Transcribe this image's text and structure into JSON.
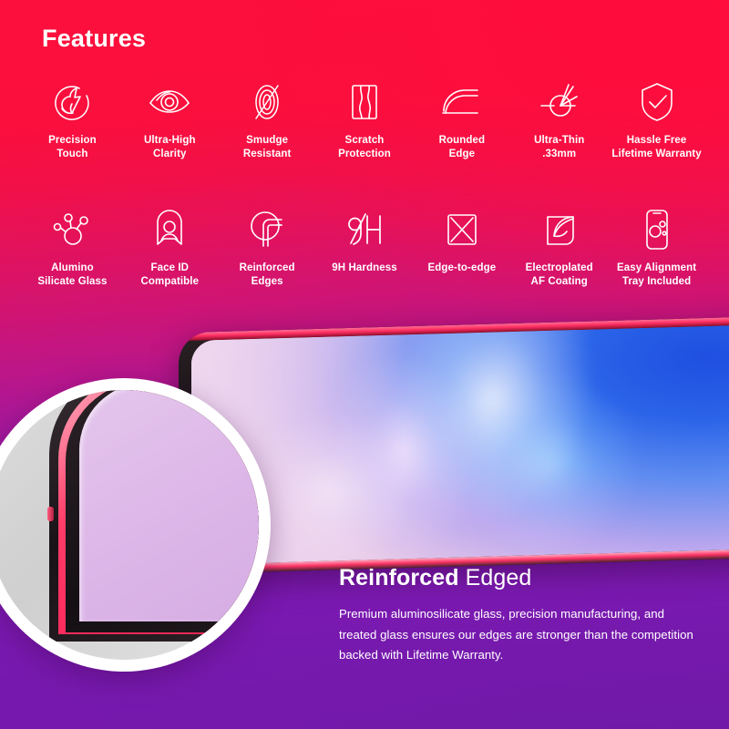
{
  "header": {
    "title": "Features"
  },
  "theme": {
    "gradient_top": "#FC113F",
    "gradient_mid": "#C2157F",
    "gradient_bottom": "#7019A8",
    "icon_color": "#FFFFFF",
    "text_color": "#FFFFFF",
    "magnifier_ring": "#FFFFFF"
  },
  "features": {
    "row1": [
      {
        "icon": "precision-touch-icon",
        "label": "Precision\nTouch"
      },
      {
        "icon": "eye-clarity-icon",
        "label": "Ultra-High\nClarity"
      },
      {
        "icon": "smudge-resistant-icon",
        "label": "Smudge\nResistant"
      },
      {
        "icon": "scratch-protection-icon",
        "label": "Scratch\nProtection"
      },
      {
        "icon": "rounded-edge-icon",
        "label": "Rounded\nEdge"
      },
      {
        "icon": "ultra-thin-caliper-icon",
        "label": "Ultra-Thin\n.33mm"
      },
      {
        "icon": "shield-check-icon",
        "label": "Hassle Free\nLifetime Warranty"
      }
    ],
    "row2": [
      {
        "icon": "molecule-icon",
        "label": "Alumino\nSilicate Glass"
      },
      {
        "icon": "face-id-icon",
        "label": "Face ID\nCompatible"
      },
      {
        "icon": "reinforced-edges-icon",
        "label": "Reinforced\nEdges"
      },
      {
        "icon": "nine-h-hardness-icon",
        "label": "9H Hardness"
      },
      {
        "icon": "edge-to-edge-icon",
        "label": "Edge-to-edge"
      },
      {
        "icon": "af-coating-icon",
        "label": "Electroplated\nAF Coating"
      },
      {
        "icon": "alignment-tray-icon",
        "label": "Easy Alignment\nTray Included"
      }
    ]
  },
  "hero": {
    "heading_strong": "Reinforced",
    "heading_light": " Edged",
    "body": "Premium aluminosilicate glass, precision manufacturing, and treated glass ensures our edges are stronger than the competition backed with Lifetime Warranty."
  }
}
